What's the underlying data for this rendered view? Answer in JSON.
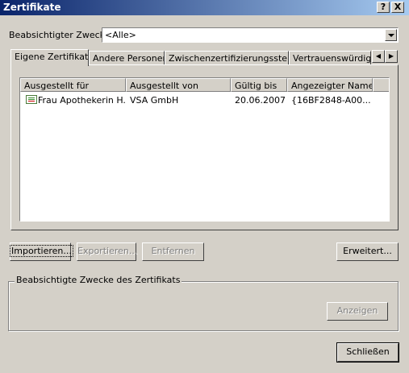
{
  "window": {
    "title": "Zertifikate",
    "help_btn": "?",
    "close_btn": "X"
  },
  "purpose": {
    "label": "Beabsichtigter Zweck:",
    "value": "<Alle>"
  },
  "tabs": [
    {
      "label": "Eigene Zertifikate",
      "active": true
    },
    {
      "label": "Andere Personen"
    },
    {
      "label": "Zwischenzertifizierungsstellen"
    },
    {
      "label": "Vertrauenswürdige Stammzertifizierungsstellen"
    }
  ],
  "tab_scroll": {
    "left": "◀",
    "right": "▶"
  },
  "table": {
    "columns": [
      "Ausgestellt für",
      "Ausgestellt von",
      "Gültig bis",
      "Angezeigter Name"
    ],
    "rows": [
      [
        "Frau Apothekerin H...",
        "VSA GmbH",
        "20.06.2007",
        "{16BF2848-A00..."
      ]
    ]
  },
  "buttons": {
    "import": "Importieren...",
    "export": "Exportieren...",
    "remove": "Entfernen",
    "advanced": "Erweitert...",
    "view": "Anzeigen",
    "close": "Schließen"
  },
  "groupbox": {
    "label": "Beabsichtigte Zwecke des Zertifikats"
  },
  "icons": {
    "certificate": "certificate-icon",
    "dropdown": "chevron-down-icon"
  }
}
